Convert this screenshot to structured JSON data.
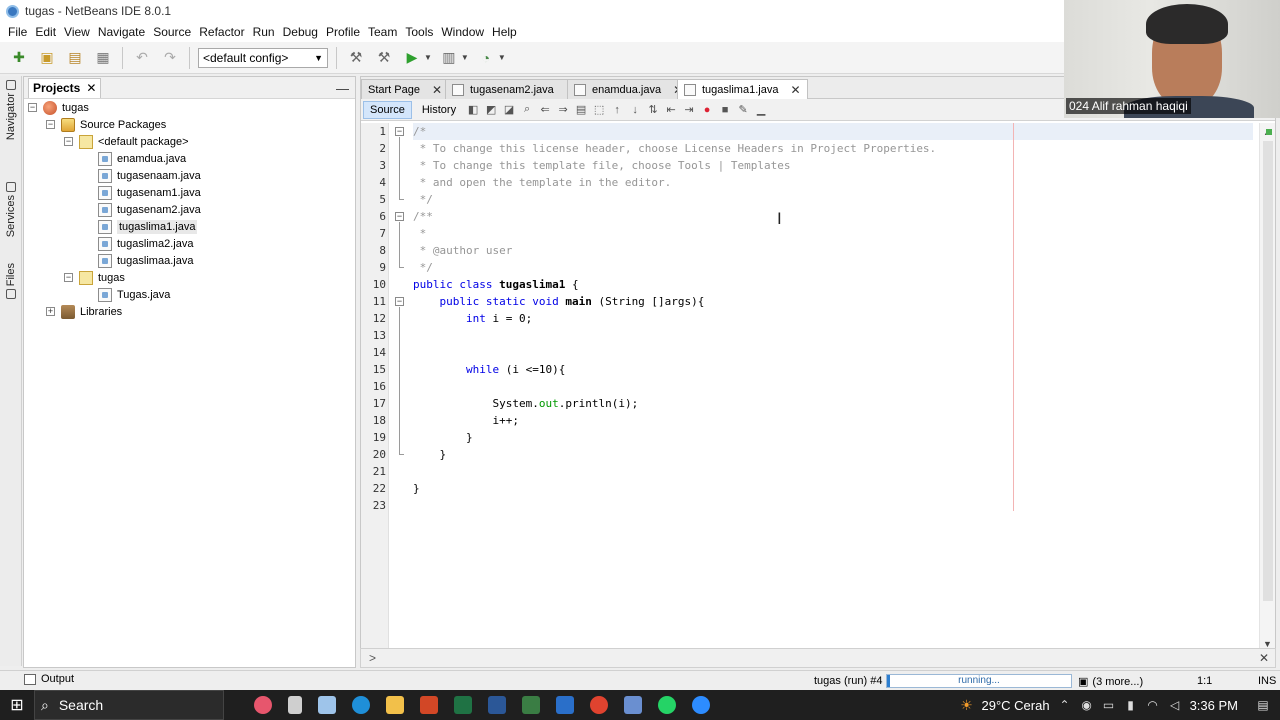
{
  "window": {
    "title": "tugas - NetBeans IDE 8.0.1"
  },
  "menu": [
    "File",
    "Edit",
    "View",
    "Navigate",
    "Source",
    "Refactor",
    "Run",
    "Debug",
    "Profile",
    "Team",
    "Tools",
    "Window",
    "Help"
  ],
  "toolbar": {
    "config": "<default config>"
  },
  "side_tabs": {
    "navigator": "Navigator",
    "services": "Services",
    "files": "Files"
  },
  "projects": {
    "title": "Projects",
    "tree": {
      "project": "tugas",
      "source_packages": "Source Packages",
      "default_package": "<default package>",
      "files": [
        "enamdua.java",
        "tugasenaam.java",
        "tugasenam1.java",
        "tugasenam2.java",
        "tugaslima1.java",
        "tugaslima2.java",
        "tugaslimaa.java"
      ],
      "tugas_package": "tugas",
      "tugas_file": "Tugas.java",
      "libraries": "Libraries"
    }
  },
  "editor": {
    "tabs": [
      "Start Page",
      "tugasenam2.java",
      "enamdua.java",
      "tugaslima1.java"
    ],
    "modes": {
      "source": "Source",
      "history": "History"
    },
    "line_numbers": [
      "1",
      "2",
      "3",
      "4",
      "5",
      "6",
      "7",
      "8",
      "9",
      "10",
      "11",
      "12",
      "13",
      "14",
      "15",
      "16",
      "17",
      "18",
      "19",
      "20",
      "21",
      "22",
      "23"
    ],
    "code": {
      "l1": "/*",
      "l2": " * To change this license header, choose License Headers in Project Properties.",
      "l3": " * To change this template file, choose Tools | Templates",
      "l4": " * and open the template in the editor.",
      "l5": " */",
      "l6": "/**",
      "l7": " *",
      "l8": " * @author user",
      "l9": " */",
      "l10_kw": "public class ",
      "l10_name": "tugaslima1",
      "l10_rest": " {",
      "l11_kw": "    public static void ",
      "l11_name": "main",
      "l11_rest": " (String []args){",
      "l12_kw": "        int",
      "l12_rest": " i = 0;",
      "l15_kw": "        while",
      "l15_rest": " (i <=10){",
      "l17_pre": "            System.",
      "l17_field": "out",
      "l17_post": ".println(i);",
      "l18": "            i++;",
      "l19": "        }",
      "l20": "    }",
      "l22": "}"
    }
  },
  "status": {
    "output": "Output",
    "run": "tugas (run) #4",
    "progress_text": "running...",
    "more": "(3 more...)",
    "position": "1:1",
    "mode": "INS"
  },
  "webcam": {
    "name": "024 Alif rahman haqiqi"
  },
  "taskbar": {
    "search": "Search",
    "weather": "29°C  Cerah",
    "time": "3:36 PM"
  }
}
